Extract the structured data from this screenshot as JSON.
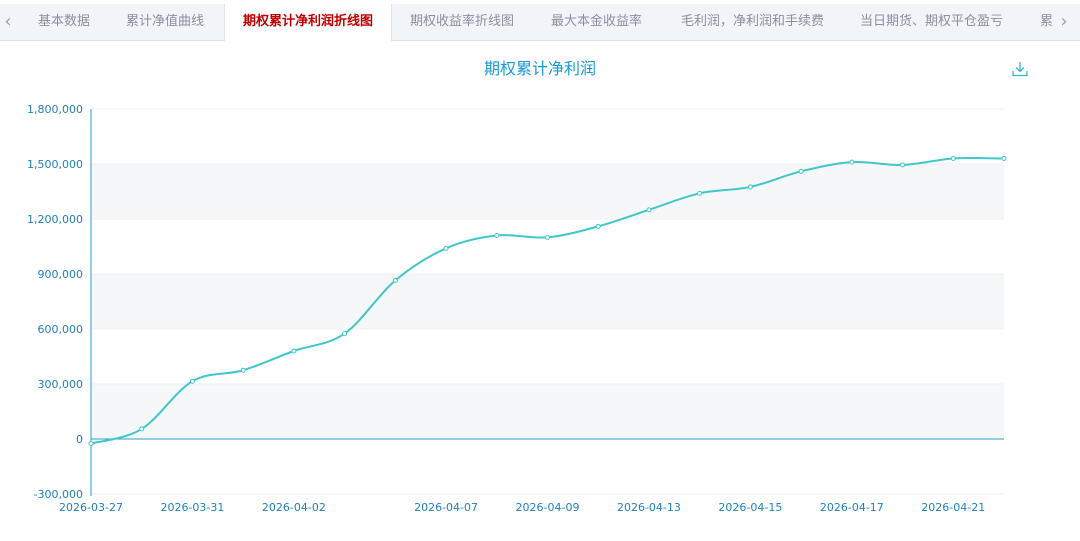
{
  "tabs": [
    {
      "label": "基本数据",
      "active": false
    },
    {
      "label": "累计净值曲线",
      "active": false
    },
    {
      "label": "期权累计净利润折线图",
      "active": true
    },
    {
      "label": "期权收益率折线图",
      "active": false
    },
    {
      "label": "最大本金收益率",
      "active": false
    },
    {
      "label": "毛利润，净利润和手续费",
      "active": false
    },
    {
      "label": "当日期货、期权平仓盈亏",
      "active": false
    },
    {
      "label": "累",
      "active": false
    }
  ],
  "nav": {
    "prev_icon": "‹",
    "next_icon": "›"
  },
  "colors": {
    "line": "#3fc7c9",
    "accent": "#1a9ad6",
    "active_tab": "#c00000"
  },
  "chart_data": {
    "type": "line",
    "title": "期权累计净利润",
    "xlabel": "",
    "ylabel": "",
    "ylim": [
      -300000,
      1800000
    ],
    "yticks": [
      -300000,
      0,
      300000,
      600000,
      900000,
      1200000,
      1500000,
      1800000
    ],
    "ytick_labels": [
      "-300,000",
      "0",
      "300,000",
      "600,000",
      "900,000",
      "1,200,000",
      "1,500,000",
      "1,800,000"
    ],
    "x_tick_labels": [
      "2026-03-27",
      "2026-03-31",
      "2026-04-02",
      "2026-04-07",
      "2026-04-09",
      "2026-04-13",
      "2026-04-15",
      "2026-04-17",
      "2026-04-21"
    ],
    "x": [
      "2026-03-27",
      "2026-03-30",
      "2026-03-31",
      "2026-04-01",
      "2026-04-02",
      "2026-04-03",
      "2026-04-06",
      "2026-04-07",
      "2026-04-08",
      "2026-04-09",
      "2026-04-10",
      "2026-04-13",
      "2026-04-14",
      "2026-04-15",
      "2026-04-16",
      "2026-04-17",
      "2026-04-20",
      "2026-04-21",
      "2026-04-22"
    ],
    "series": [
      {
        "values": [
          -25000,
          55000,
          315000,
          375000,
          480000,
          575000,
          865000,
          1040000,
          1110000,
          1100000,
          1160000,
          1250000,
          1340000,
          1375000,
          1460000,
          1510000,
          1495000,
          1530000,
          1530000
        ]
      }
    ],
    "grid": true,
    "legend": "none"
  }
}
